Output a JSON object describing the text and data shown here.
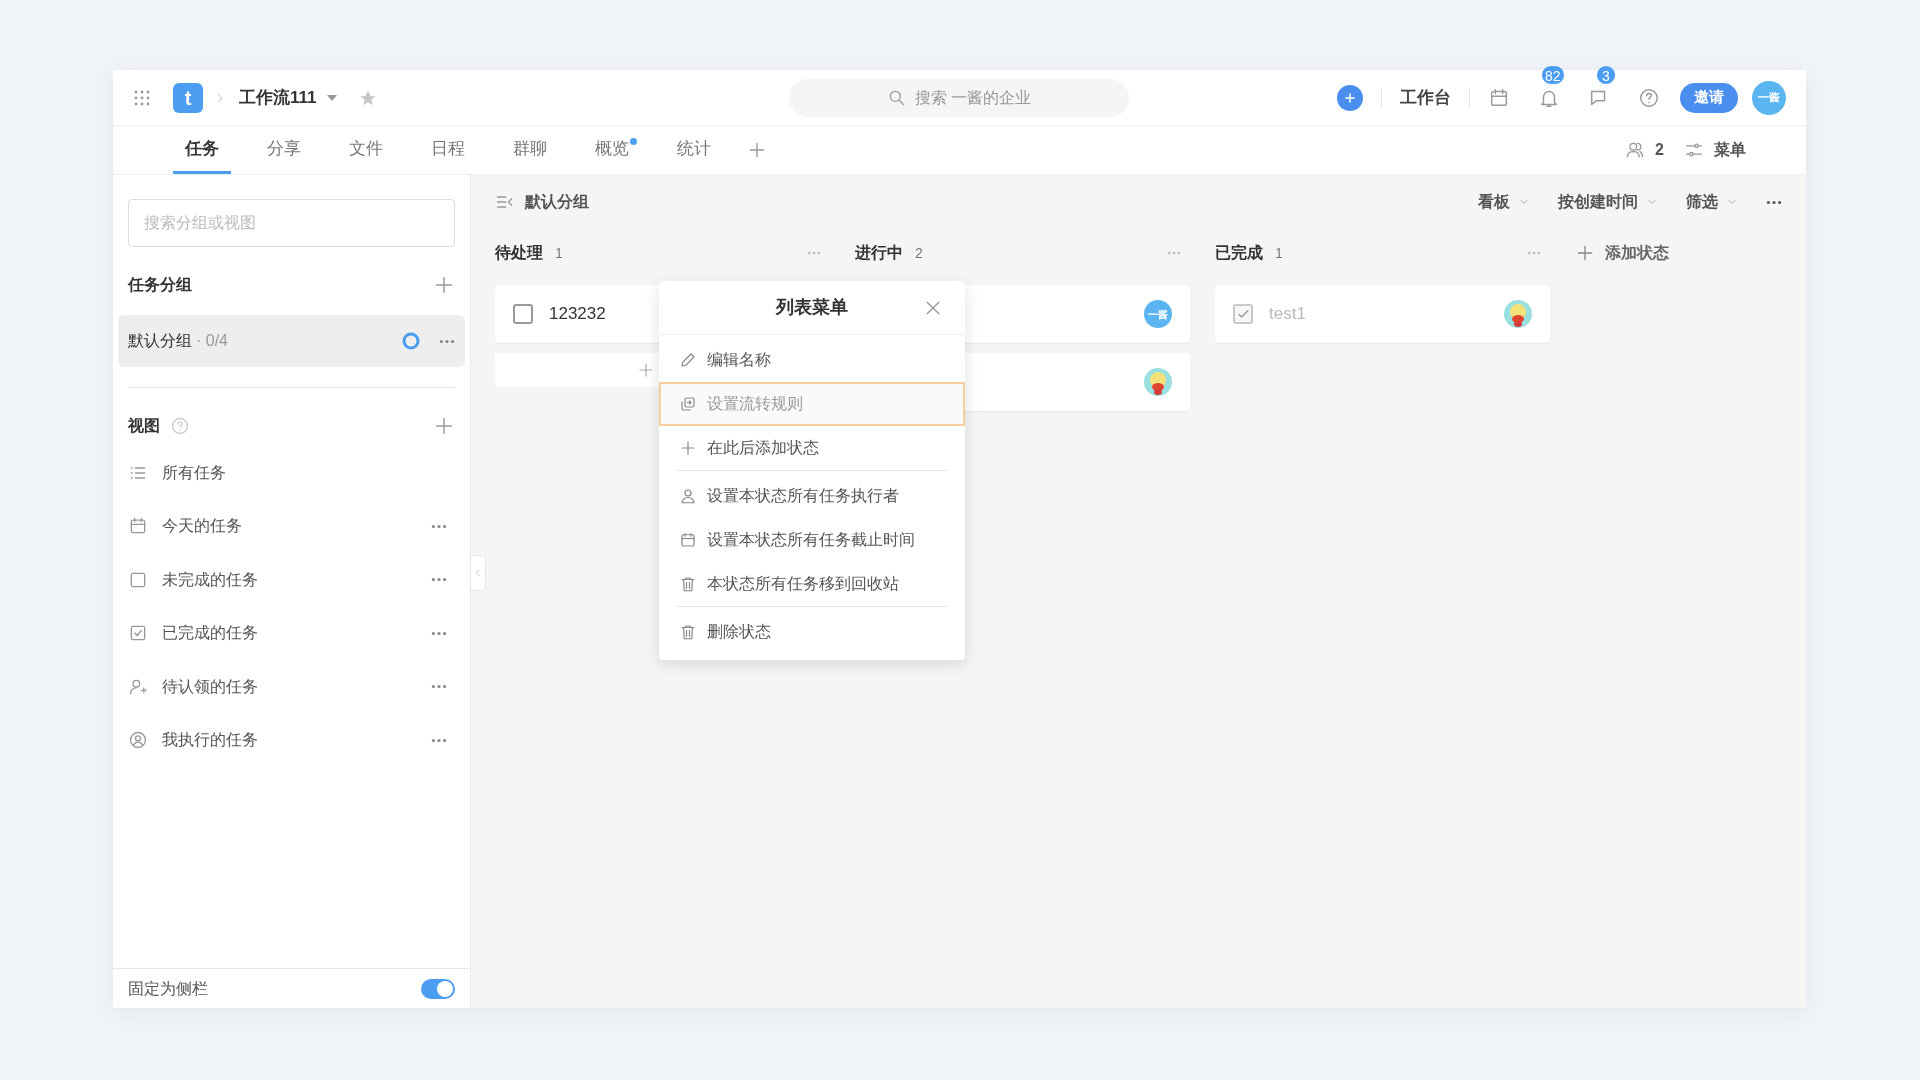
{
  "header": {
    "app_letter": "t",
    "project": "工作流111",
    "search": {
      "placeholder": "搜索 一酱的企业"
    },
    "workbench": "工作台",
    "notification_badge": "82",
    "message_badge": "3",
    "invite": "邀请",
    "avatar": "一酱"
  },
  "tabs": [
    {
      "label": "任务",
      "selected": true,
      "dot": false
    },
    {
      "label": "分享",
      "selected": false,
      "dot": false
    },
    {
      "label": "文件",
      "selected": false,
      "dot": false
    },
    {
      "label": "日程",
      "selected": false,
      "dot": false
    },
    {
      "label": "群聊",
      "selected": false,
      "dot": false
    },
    {
      "label": "概览",
      "selected": false,
      "dot": true
    },
    {
      "label": "统计",
      "selected": false,
      "dot": false
    }
  ],
  "tab_tools": {
    "members": "2",
    "menu": "菜单"
  },
  "sidebar": {
    "search": {
      "placeholder": "搜索分组或视图"
    },
    "groups_title": "任务分组",
    "groups": [
      {
        "name": "默认分组",
        "progress": "· 0/4",
        "selected": true
      }
    ],
    "views_title": "视图",
    "views": [
      {
        "kind": "list",
        "label": "所有任务",
        "more": false
      },
      {
        "kind": "calendar",
        "label": "今天的任务",
        "more": true
      },
      {
        "kind": "box",
        "label": "未完成的任务",
        "more": true
      },
      {
        "kind": "checkbox",
        "label": "已完成的任务",
        "more": true
      },
      {
        "kind": "person-add",
        "label": "待认领的任务",
        "more": true
      },
      {
        "kind": "person-circle",
        "label": "我执行的任务",
        "more": true
      }
    ],
    "pin": {
      "label": "固定为侧栏",
      "on": true
    }
  },
  "board": {
    "group": "默认分组",
    "controls": [
      "看板",
      "按创建时间",
      "筛选"
    ],
    "columns": [
      {
        "name": "待处理",
        "count": "1",
        "cards": [
          {
            "kind": "task",
            "title": "123232",
            "done": false
          },
          {
            "kind": "add"
          }
        ]
      },
      {
        "name": "进行中",
        "count": "2",
        "cards": [
          {
            "kind": "task",
            "avatar": {
              "kind": "initials",
              "text": "一酱"
            }
          },
          {
            "kind": "task"
          }
        ]
      },
      {
        "name": "已完成",
        "count": "1",
        "cards": [
          {
            "kind": "task",
            "title": "test1",
            "done": true
          }
        ]
      }
    ],
    "add_status": "添加状态"
  },
  "menu": {
    "title": "列表菜单",
    "sections": [
      [
        {
          "kind": "pencil",
          "label": "编辑名称",
          "selected": false
        },
        {
          "kind": "flow",
          "label": "设置流转规则",
          "selected": true
        },
        {
          "kind": "plus",
          "label": "在此后添加状态",
          "selected": false
        }
      ],
      [
        {
          "kind": "person",
          "label": "设置本状态所有任务执行者",
          "selected": false
        },
        {
          "kind": "calendar",
          "label": "设置本状态所有任务截止时间",
          "selected": false
        },
        {
          "kind": "trash",
          "label": "本状态所有任务移到回收站",
          "selected": false
        }
      ],
      [
        {
          "kind": "trash",
          "label": "删除状态",
          "selected": false
        }
      ]
    ]
  }
}
